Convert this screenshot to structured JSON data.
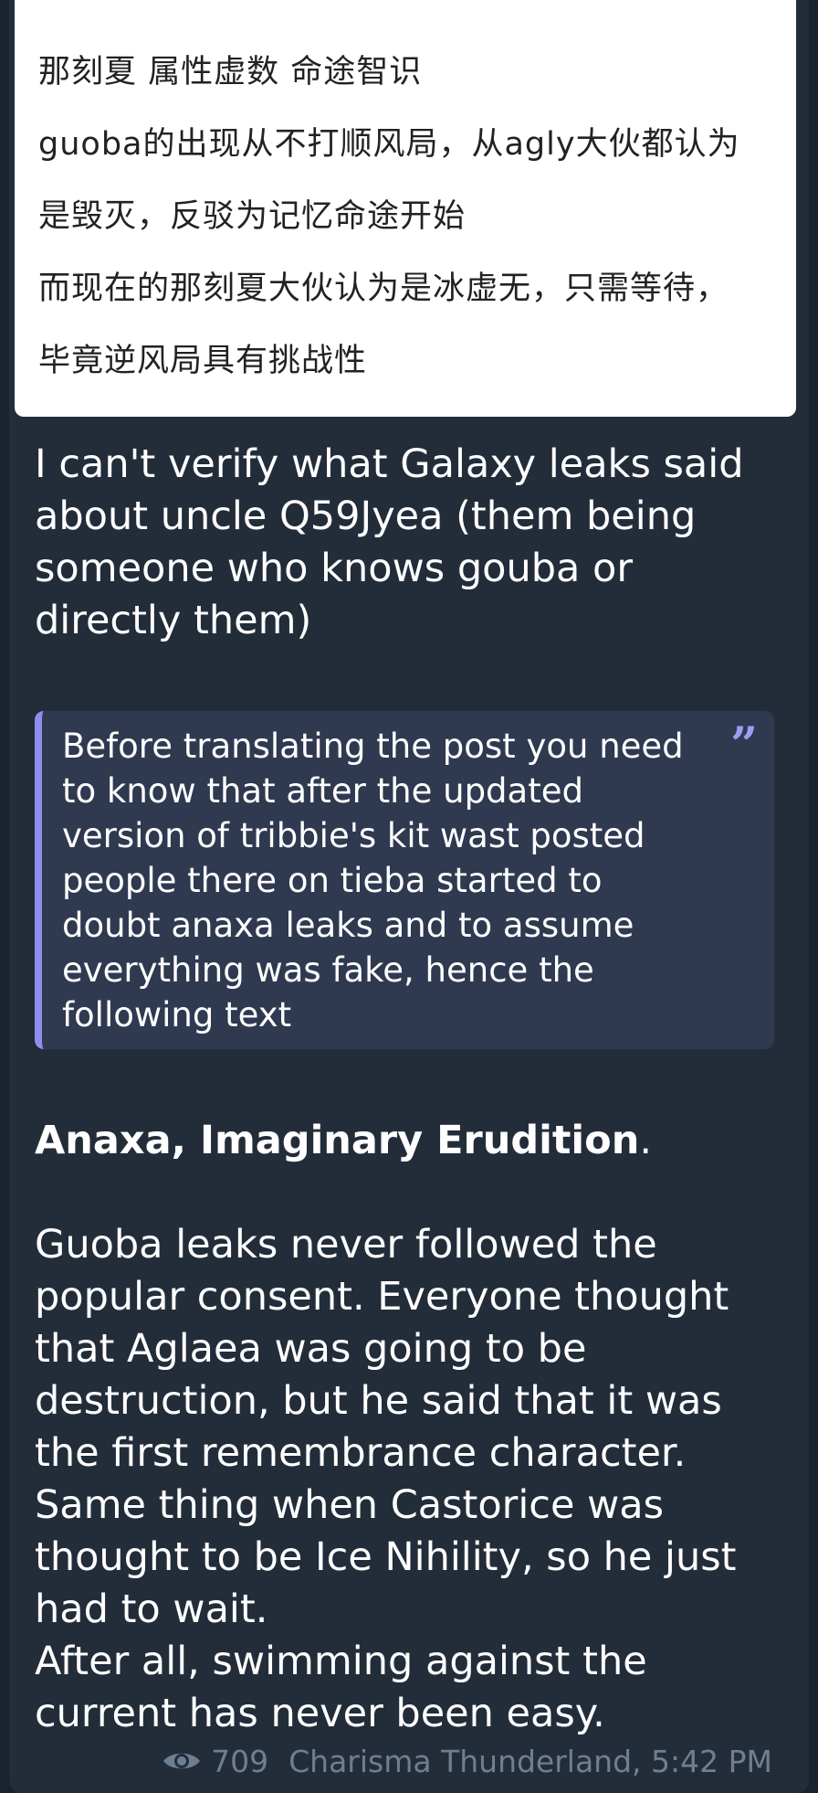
{
  "image_card": {
    "lines": [
      "那刻夏 属性虚数 命途智识",
      "guoba的出现从不打顺风局，从agly大伙都认为",
      "是毁灭，反驳为记忆命途开始",
      "而现在的那刻夏大伙认为是冰虚无，只需等待，",
      "毕竟逆风局具有挑战性"
    ]
  },
  "message": {
    "intro": "I can't verify what Galaxy leaks said about uncle Q59Jyea (them being someone who knows gouba or directly them)",
    "quote": "Before translating the post you need to know that after the updated version of tribbie's kit wast posted people there on tieba started to doubt anaxa leaks and to assume everything was fake, hence the following text",
    "heading": "Anaxa, Imaginary Erudition",
    "heading_suffix": ".",
    "paragraph_1": "Guoba leaks never followed the popular consent. Everyone thought that Aglaea was going to be destruction, but he said that it was the first remembrance character.",
    "paragraph_2": "Same thing when Castorice was thought to be Ice Nihility, so he just had to wait.",
    "paragraph_3": "After all, swimming against the current has never been easy."
  },
  "footer": {
    "views": "709",
    "author_time": "Charisma Thunderland, 5:42 PM"
  },
  "colors": {
    "background": "#1a222d",
    "bubble": "#232d3a",
    "quote_bg": "#2f3950",
    "quote_accent": "#8f8ef0",
    "meta_text": "#6f7f92"
  },
  "icons": {
    "quote": "quote-mark-icon",
    "views": "eye-icon"
  }
}
